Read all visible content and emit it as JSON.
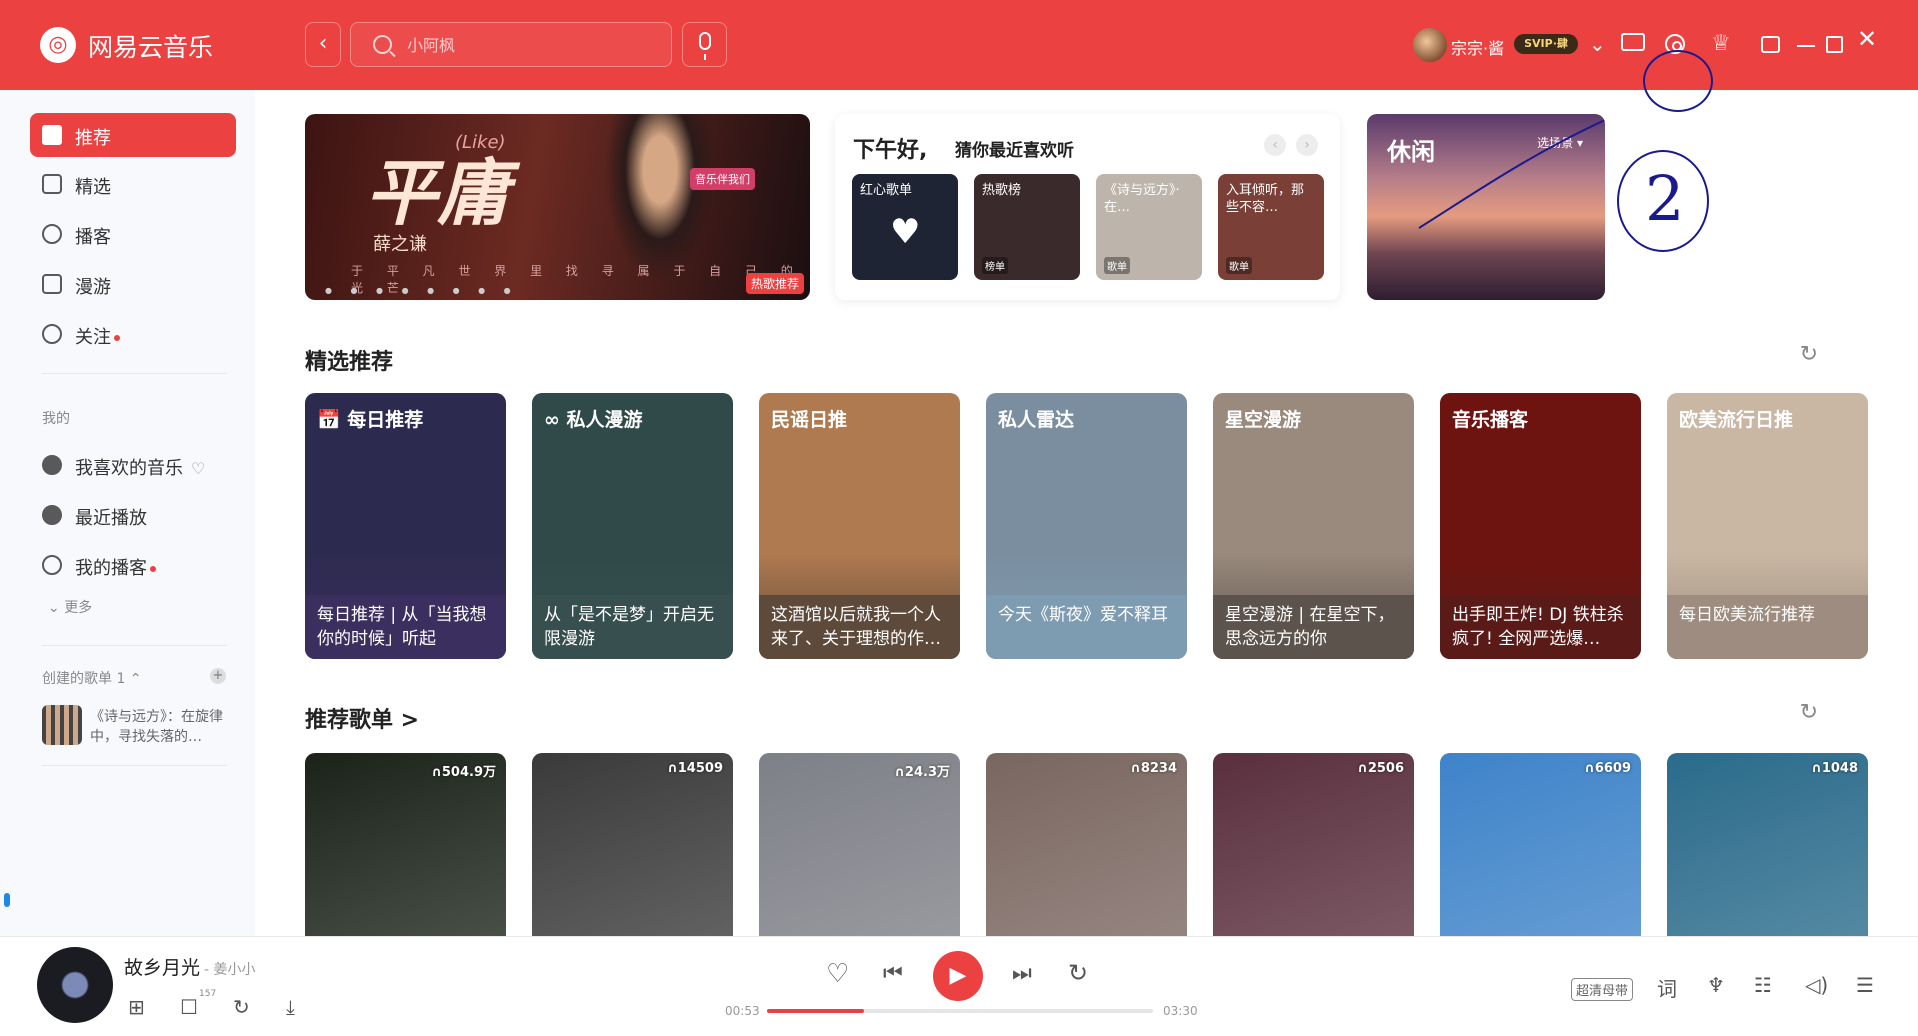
{
  "header": {
    "app_name": "网易云音乐",
    "logo_glyph": "◎",
    "search_placeholder": "小阿枫",
    "username": "宗宗·酱",
    "vip_badge": "SVIP·肆"
  },
  "sidebar": {
    "main_items": [
      {
        "label": "推荐",
        "active": true
      },
      {
        "label": "精选"
      },
      {
        "label": "播客"
      },
      {
        "label": "漫游"
      },
      {
        "label": "关注",
        "dot": true
      }
    ],
    "my_heading": "我的",
    "my_items": [
      {
        "label": "我喜欢的音乐"
      },
      {
        "label": "最近播放"
      },
      {
        "label": "我的播客",
        "dot": true
      }
    ],
    "more_label": "更多",
    "created_heading": "创建的歌单 1",
    "created_playlist": "《诗与远方》：在旋律中，寻找失落的…"
  },
  "banner": {
    "title": "平庸",
    "title_tag": "(Like)",
    "artist": "薛之谦",
    "lyrics": "于 平 凡 世 界 里 找 寻 属 于 自 己 的 光 芒",
    "promo": "音乐伴我们",
    "tag": "热歌推荐"
  },
  "greeting": {
    "title": "下午好,",
    "subtitle": "猜你最近喜欢听",
    "items": [
      {
        "label": "红心歌单",
        "bg": "#1e2434"
      },
      {
        "label": "热歌榜",
        "tag": "榜单",
        "bg": "#3a2a2c"
      },
      {
        "label": "《诗与远方》·在…",
        "tag": "歌单",
        "bg": "#bdb4ab"
      },
      {
        "label": "入耳倾听，那些不容…",
        "tag": "歌单",
        "bg": "#7a3f37"
      }
    ]
  },
  "scene": {
    "title": "休闲",
    "button": "选场景 ▾"
  },
  "featured": {
    "title": "精选推荐",
    "items": [
      {
        "title": "📅 每日推荐",
        "desc": "每日推荐 | 从「当我想你的时候」听起",
        "bg": "#2d2a4f",
        "band": "#3a2f5f"
      },
      {
        "title": "∞ 私人漫游",
        "desc": "从「是不是梦」开启无限漫游",
        "bg": "#2f4a49",
        "band": "#37504f"
      },
      {
        "title": "民谣日推",
        "desc": "这酒馆以后就我一个人来了、关于理想的作…",
        "bg": "#b07a50",
        "band": "#5e4a3b"
      },
      {
        "title": "私人雷达",
        "desc": "今天《斯夜》爱不释耳",
        "bg": "#7b8ea0",
        "band": "#7d9bb1"
      },
      {
        "title": "星空漫游",
        "desc": "星空漫游 | 在星空下，思念远方的你",
        "bg": "#9a8a7d",
        "band": "#5d534d"
      },
      {
        "title": "音乐播客",
        "desc": "出手即王炸! DJ 铁柱杀疯了! 全网严选爆…",
        "bg": "#6e1410",
        "band": "#5a1a17"
      },
      {
        "title": "欧美流行日推",
        "desc": "每日欧美流行推荐",
        "bg": "#c9b7a3",
        "band": "#9d8c7f"
      }
    ]
  },
  "recommended": {
    "title": "推荐歌单 >",
    "items": [
      {
        "count": "504.9万",
        "bg": "#1b2319"
      },
      {
        "count": "14509",
        "bg": "#3a3a3a"
      },
      {
        "count": "24.3万",
        "bg": "#7e8087"
      },
      {
        "count": "8234",
        "bg": "#7a6660"
      },
      {
        "count": "2506",
        "bg": "#5a2f3e"
      },
      {
        "count": "6609",
        "bg": "#3e83c9"
      },
      {
        "count": "1048",
        "bg": "#2a6b8b"
      }
    ]
  },
  "player": {
    "song": "故乡月光",
    "artist": "- 姜小小",
    "comment_count": "157",
    "time_current": "00:53",
    "time_total": "03:30",
    "progress": 0.25,
    "buffered": 0.29,
    "quality": "超清母带",
    "lyrics_btn": "词"
  },
  "colors": {
    "accent": "#ec4141",
    "annotation_ink": "#1a1a8e"
  }
}
